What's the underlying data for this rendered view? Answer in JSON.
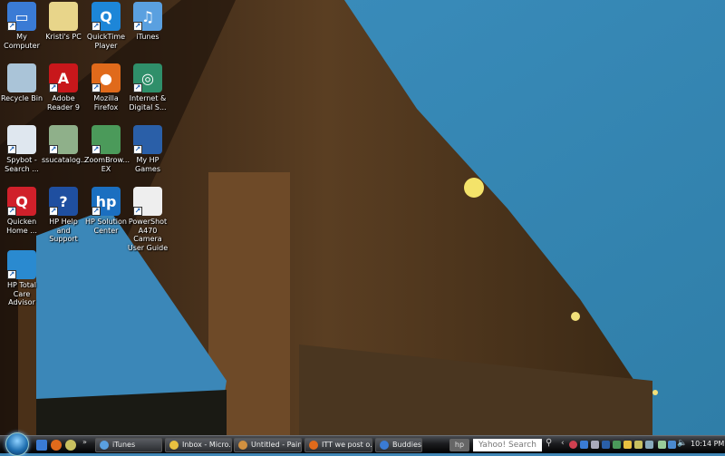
{
  "desktop": {
    "icons": [
      {
        "label": "My Computer",
        "color": "#3a7bd5",
        "glyph": "▭"
      },
      {
        "label": "Kristi's PC",
        "color": "#e8d58a",
        "glyph": ""
      },
      {
        "label": "QuickTime Player",
        "color": "#1d86d8",
        "glyph": "Q"
      },
      {
        "label": "iTunes",
        "color": "#5aa0e0",
        "glyph": "♫"
      },
      {
        "label": "Recycle Bin",
        "color": "#aac4d8",
        "glyph": ""
      },
      {
        "label": "Adobe Reader 9",
        "color": "#c8171b",
        "glyph": "A"
      },
      {
        "label": "Mozilla Firefox",
        "color": "#e06a1b",
        "glyph": "●"
      },
      {
        "label": "Internet & Digital S...",
        "color": "#2f8f6a",
        "glyph": "◎"
      },
      {
        "label": "Spybot - Search ...",
        "color": "#dfe7ef",
        "glyph": ""
      },
      {
        "label": "ssucatalog...",
        "color": "#8fb08a",
        "glyph": ""
      },
      {
        "label": "ZoomBrow... EX",
        "color": "#4b9a5a",
        "glyph": ""
      },
      {
        "label": "My HP Games",
        "color": "#2a5fa8",
        "glyph": ""
      },
      {
        "label": "Quicken Home ...",
        "color": "#d0202a",
        "glyph": "Q"
      },
      {
        "label": "HP Help and Support",
        "color": "#1f4fa0",
        "glyph": "?"
      },
      {
        "label": "HP Solution Center",
        "color": "#1b6fc0",
        "glyph": "hp"
      },
      {
        "label": "PowerShot A470 Camera User Guide",
        "color": "#eeeeee",
        "glyph": ""
      },
      {
        "label": "HP Total Care Advisor",
        "color": "#2a8ad0",
        "glyph": ""
      }
    ]
  },
  "taskbar": {
    "tasks": [
      {
        "label": "iTunes",
        "color": "#5aa0e0"
      },
      {
        "label": "Inbox - Micro...",
        "color": "#e8c040"
      },
      {
        "label": "Untitled - Paint",
        "color": "#d09040"
      },
      {
        "label": "ITT we post o...",
        "color": "#e06a1b"
      },
      {
        "label": "Buddies",
        "color": "#3a7bd5"
      }
    ],
    "search_placeholder": "Yahoo! Search",
    "chevron": "»",
    "clock": "10:14 PM"
  }
}
